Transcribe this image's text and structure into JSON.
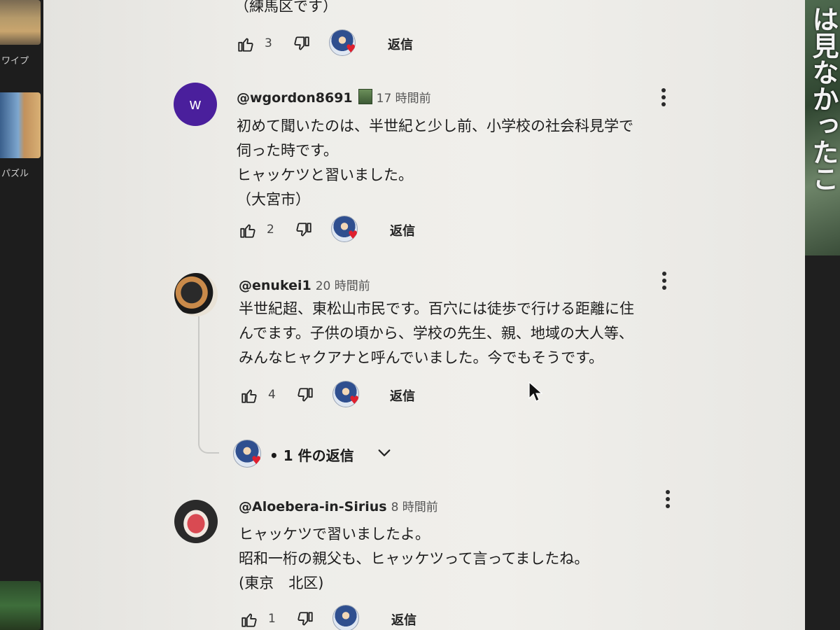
{
  "sidebar": {
    "labels": [
      "ワイプ",
      "パズル"
    ]
  },
  "right_panel": {
    "text": "は見なかったこ"
  },
  "top_fragment": {
    "text": "（練馬区です）",
    "likes": "3",
    "reply_label": "返信"
  },
  "comments": [
    {
      "avatar_letter": "w",
      "handle": "@wgordon8691",
      "time": "17 時間前",
      "body": "初めて聞いたのは、半世紀と少し前、小学校の社会科見学で\n伺った時です。\nヒャッケツと習いました。\n（大宮市）",
      "likes": "2",
      "reply_label": "返信"
    },
    {
      "handle": "@enukei1",
      "time": "20 時間前",
      "body": "半世紀超、東松山市民です。百穴には徒歩で行ける距離に住\nんでます。子供の頃から、学校の先生、親、地域の大人等、\nみんなヒャクアナと呼んでいました。今でもそうです。",
      "likes": "4",
      "reply_label": "返信",
      "replies_label": "• 1 件の返信"
    },
    {
      "handle": "@Aloebera-in-Sirius",
      "time": "8 時間前",
      "body": "ヒャッケツで習いましたよ。\n昭和一桁の親父も、ヒャッケツって言ってましたね。\n(東京　北区)",
      "likes": "1",
      "reply_label": "返信"
    }
  ],
  "colors": {
    "avatar_w": "#4a1f9c",
    "heart": "#e0202e",
    "panel_bg": "#efeeea"
  }
}
